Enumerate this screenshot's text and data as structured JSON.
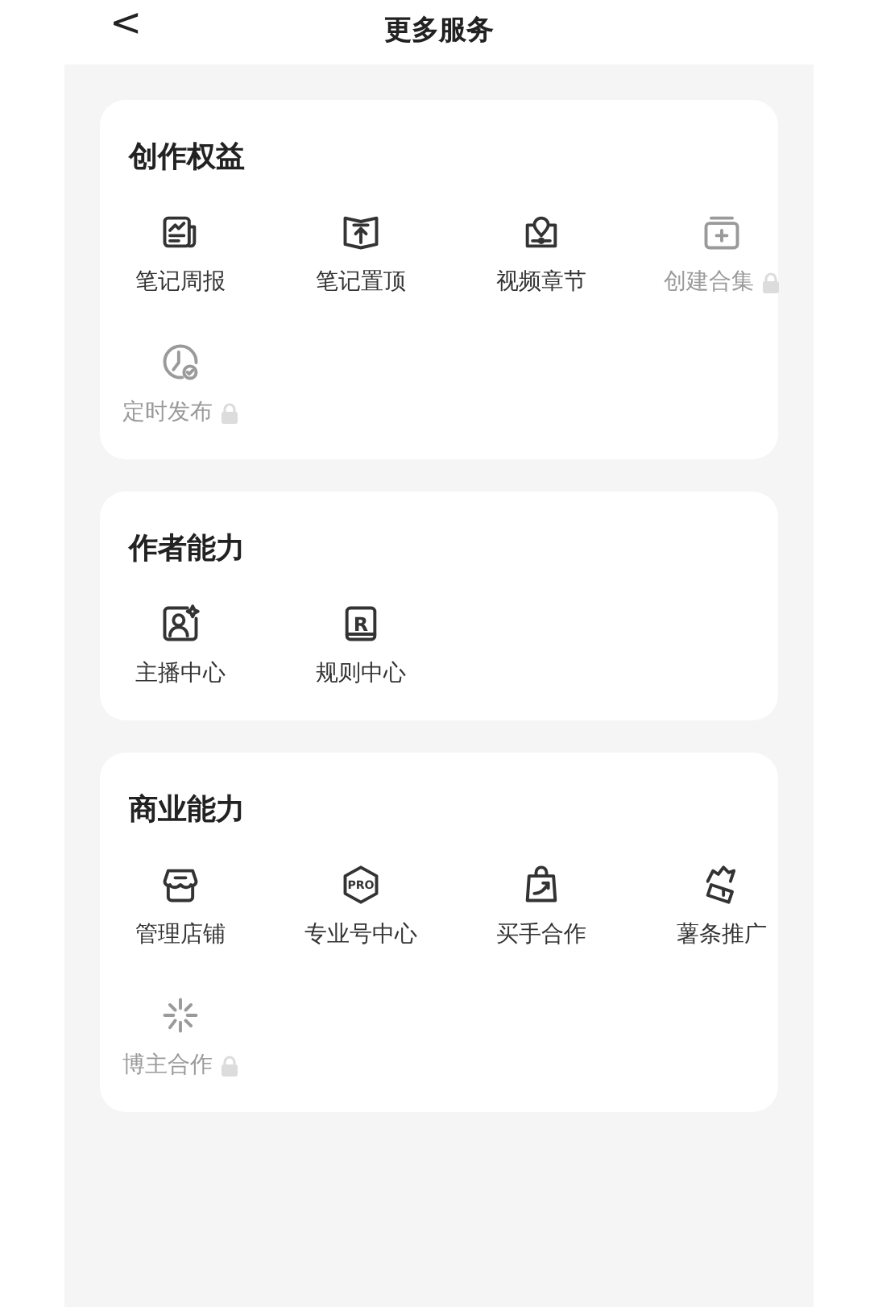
{
  "header": {
    "back": "<",
    "title": "更多服务"
  },
  "sections": [
    {
      "title": "创作权益",
      "items": [
        {
          "label": "笔记周报",
          "locked": false
        },
        {
          "label": "笔记置顶",
          "locked": false
        },
        {
          "label": "视频章节",
          "locked": false
        },
        {
          "label": "创建合集",
          "locked": true
        },
        {
          "label": "定时发布",
          "locked": true
        }
      ]
    },
    {
      "title": "作者能力",
      "items": [
        {
          "label": "主播中心",
          "locked": false
        },
        {
          "label": "规则中心",
          "locked": false,
          "icon_text": "R"
        }
      ]
    },
    {
      "title": "商业能力",
      "items": [
        {
          "label": "管理店铺",
          "locked": false
        },
        {
          "label": "专业号中心",
          "locked": false,
          "icon_text": "PRO"
        },
        {
          "label": "买手合作",
          "locked": false
        },
        {
          "label": "薯条推广",
          "locked": false
        },
        {
          "label": "博主合作",
          "locked": true
        }
      ]
    }
  ]
}
